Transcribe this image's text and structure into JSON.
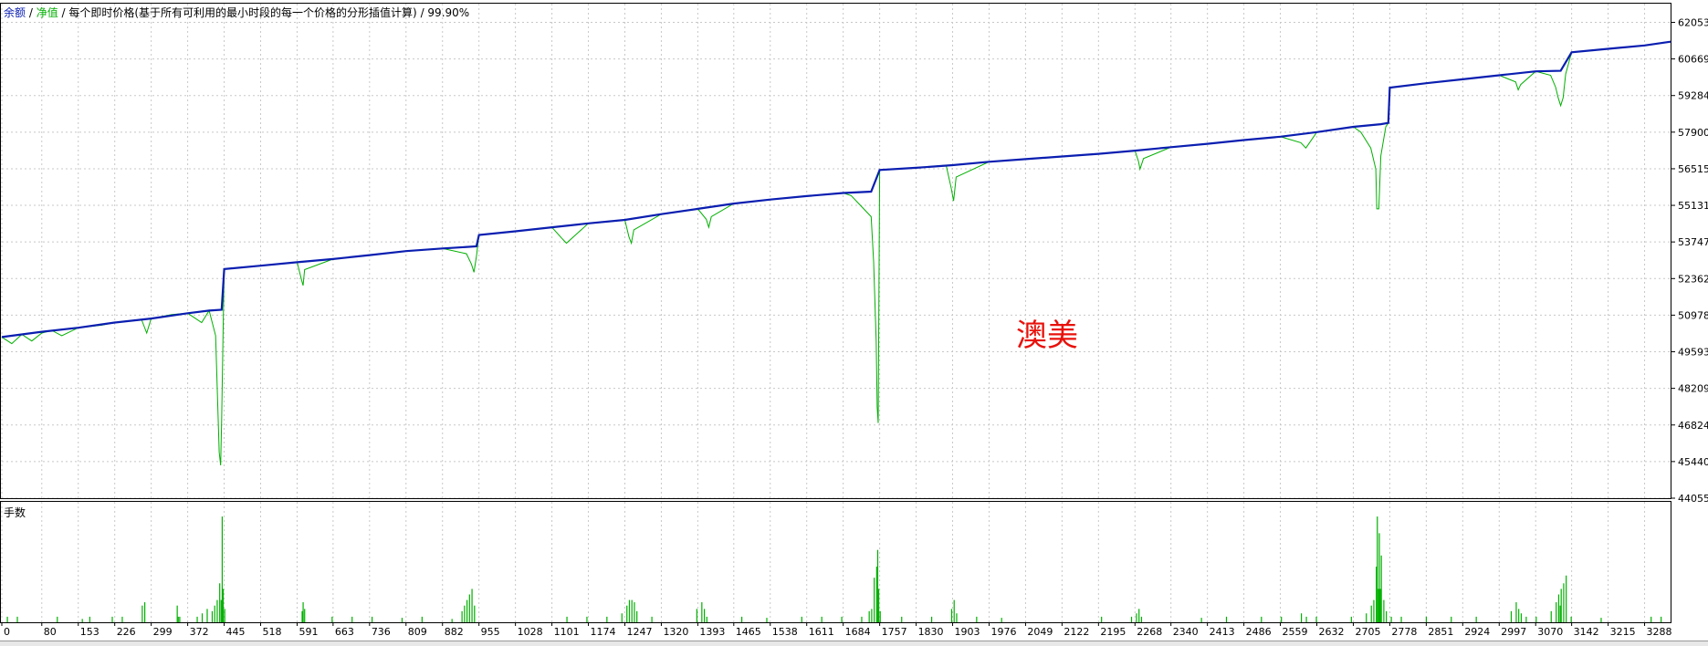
{
  "header": {
    "balance_label": "余额",
    "sep1": " / ",
    "equity_label": "净值",
    "sep2": " / ",
    "model_text": "每个即时价格(基于所有可利用的最小时段的每一个价格的分形插值计算)",
    "sep3": " / ",
    "quality": "99.90%"
  },
  "watermark": "澳美",
  "colors": {
    "balance": "#0a1eb0",
    "equity": "#00b000",
    "lots": "#00b000",
    "watermark": "#e8110b"
  },
  "chart_data": [
    {
      "type": "line",
      "title": "",
      "ylim": [
        44055,
        62760
      ],
      "y_ticks": [
        "62053",
        "60669",
        "59284",
        "57900",
        "56515",
        "55131",
        "53747",
        "52362",
        "50978",
        "49593",
        "48209",
        "46824",
        "45440",
        "44055"
      ],
      "x_range": [
        0,
        3340
      ],
      "grid": true,
      "series": [
        {
          "name": "余额",
          "x": [
            0,
            80,
            153,
            226,
            299,
            372,
            415,
            440,
            445,
            518,
            591,
            663,
            736,
            809,
            882,
            950,
            955,
            1028,
            1101,
            1174,
            1247,
            1320,
            1393,
            1465,
            1538,
            1611,
            1684,
            1740,
            1757,
            1830,
            1903,
            1976,
            2049,
            2122,
            2195,
            2268,
            2340,
            2413,
            2486,
            2559,
            2632,
            2705,
            2760,
            2775,
            2778,
            2851,
            2924,
            2997,
            3070,
            3120,
            3142,
            3215,
            3288,
            3340
          ],
          "y": [
            50150,
            50350,
            50500,
            50700,
            50850,
            51050,
            51150,
            51180,
            52720,
            52850,
            52980,
            53100,
            53250,
            53400,
            53500,
            53580,
            54010,
            54150,
            54300,
            54450,
            54580,
            54800,
            55000,
            55200,
            55350,
            55480,
            55600,
            55650,
            56470,
            56550,
            56650,
            56780,
            56880,
            56980,
            57080,
            57200,
            57330,
            57460,
            57600,
            57730,
            57900,
            58100,
            58200,
            58250,
            59580,
            59750,
            59900,
            60050,
            60200,
            60220,
            60920,
            61050,
            61180,
            61320
          ]
        },
        {
          "name": "净值",
          "x": [
            0,
            20,
            40,
            60,
            80,
            100,
            120,
            153,
            200,
            226,
            280,
            290,
            299,
            340,
            372,
            400,
            415,
            428,
            435,
            438,
            440,
            443,
            445,
            518,
            591,
            600,
            603,
            606,
            663,
            736,
            809,
            882,
            930,
            940,
            945,
            950,
            955,
            1028,
            1101,
            1120,
            1130,
            1174,
            1247,
            1255,
            1260,
            1265,
            1320,
            1393,
            1410,
            1415,
            1420,
            1465,
            1538,
            1611,
            1684,
            1700,
            1720,
            1740,
            1745,
            1750,
            1752,
            1754,
            1757,
            1830,
            1890,
            1900,
            1905,
            1910,
            1976,
            2049,
            2122,
            2195,
            2268,
            2275,
            2278,
            2285,
            2340,
            2413,
            2486,
            2559,
            2600,
            2610,
            2632,
            2705,
            2720,
            2740,
            2750,
            2752,
            2756,
            2760,
            2770,
            2775,
            2778,
            2851,
            2924,
            2997,
            3030,
            3035,
            3040,
            3070,
            3100,
            3110,
            3115,
            3120,
            3125,
            3130,
            3142,
            3215,
            3288,
            3340
          ],
          "y": [
            50150,
            49900,
            50250,
            50000,
            50300,
            50400,
            50200,
            50500,
            50600,
            50700,
            50800,
            50300,
            50850,
            51000,
            51050,
            50700,
            51150,
            50200,
            45800,
            45300,
            47000,
            50600,
            52720,
            52850,
            52980,
            52300,
            52100,
            52700,
            53100,
            53250,
            53400,
            53500,
            53300,
            52900,
            52600,
            53200,
            54010,
            54150,
            54300,
            53900,
            53700,
            54450,
            54580,
            53950,
            53700,
            54200,
            54800,
            55000,
            54600,
            54300,
            54700,
            55200,
            55350,
            55480,
            55600,
            55500,
            55100,
            54700,
            53000,
            50000,
            47500,
            46900,
            56470,
            56550,
            56650,
            55800,
            55300,
            56200,
            56780,
            56880,
            56980,
            57080,
            57200,
            56800,
            56500,
            56900,
            57330,
            57460,
            57600,
            57730,
            57500,
            57300,
            57900,
            58100,
            57900,
            57300,
            56500,
            55000,
            55000,
            57000,
            58100,
            58250,
            59580,
            59750,
            59900,
            60050,
            59800,
            59500,
            59700,
            60200,
            60050,
            59600,
            59200,
            58900,
            59200,
            60100,
            60920,
            61050,
            61180,
            61320
          ]
        }
      ]
    },
    {
      "type": "bar",
      "title": "手数",
      "x_ticks": [
        "0",
        "80",
        "153",
        "226",
        "299",
        "372",
        "445",
        "518",
        "591",
        "663",
        "736",
        "809",
        "882",
        "955",
        "1028",
        "1101",
        "1174",
        "1247",
        "1320",
        "1393",
        "1465",
        "1538",
        "1611",
        "1684",
        "1757",
        "1830",
        "1903",
        "1976",
        "2049",
        "2122",
        "2195",
        "2268",
        "2340",
        "2413",
        "2486",
        "2559",
        "2632",
        "2705",
        "2778",
        "2851",
        "2924",
        "2997",
        "3070",
        "3142",
        "3215",
        "3288"
      ],
      "ylim": [
        0,
        1.0
      ],
      "x": [
        10,
        30,
        110,
        160,
        175,
        220,
        240,
        280,
        285,
        350,
        352,
        355,
        390,
        400,
        410,
        420,
        425,
        430,
        435,
        438,
        440,
        442,
        445,
        600,
        602,
        605,
        660,
        700,
        740,
        800,
        840,
        900,
        920,
        925,
        930,
        935,
        940,
        945,
        1130,
        1170,
        1210,
        1240,
        1250,
        1255,
        1260,
        1265,
        1270,
        1300,
        1390,
        1400,
        1405,
        1410,
        1480,
        1530,
        1600,
        1640,
        1680,
        1720,
        1735,
        1740,
        1745,
        1750,
        1752,
        1754,
        1757,
        1800,
        1860,
        1900,
        1905,
        1910,
        1950,
        2000,
        2200,
        2260,
        2270,
        2275,
        2280,
        2400,
        2450,
        2520,
        2560,
        2600,
        2610,
        2630,
        2700,
        2730,
        2740,
        2745,
        2750,
        2752,
        2754,
        2756,
        2758,
        2760,
        2765,
        2770,
        2780,
        2800,
        2850,
        2900,
        2950,
        3020,
        3030,
        3035,
        3040,
        3050,
        3070,
        3100,
        3110,
        3115,
        3118,
        3120,
        3125,
        3130,
        3140,
        3200,
        3300,
        3320
      ],
      "values": [
        0.05,
        0.05,
        0.05,
        0.03,
        0.05,
        0.05,
        0.05,
        0.15,
        0.18,
        0.15,
        0.05,
        0.05,
        0.05,
        0.08,
        0.12,
        0.1,
        0.15,
        0.2,
        0.35,
        0.2,
        0.95,
        0.3,
        0.12,
        0.1,
        0.18,
        0.12,
        0.05,
        0.05,
        0.05,
        0.04,
        0.05,
        0.03,
        0.1,
        0.15,
        0.2,
        0.25,
        0.3,
        0.15,
        0.05,
        0.05,
        0.05,
        0.08,
        0.15,
        0.2,
        0.2,
        0.18,
        0.1,
        0.05,
        0.12,
        0.18,
        0.12,
        0.05,
        0.05,
        0.04,
        0.05,
        0.05,
        0.05,
        0.05,
        0.1,
        0.12,
        0.4,
        0.5,
        0.65,
        0.3,
        0.1,
        0.05,
        0.05,
        0.12,
        0.2,
        0.08,
        0.05,
        0.04,
        0.05,
        0.05,
        0.08,
        0.12,
        0.05,
        0.04,
        0.05,
        0.05,
        0.05,
        0.08,
        0.05,
        0.05,
        0.05,
        0.08,
        0.15,
        0.2,
        0.5,
        0.95,
        0.3,
        0.8,
        0.3,
        0.6,
        0.2,
        0.1,
        0.05,
        0.05,
        0.05,
        0.05,
        0.05,
        0.1,
        0.18,
        0.12,
        0.08,
        0.05,
        0.05,
        0.1,
        0.18,
        0.25,
        0.15,
        0.3,
        0.35,
        0.42,
        0.05,
        0.04,
        0.05,
        0.05
      ]
    }
  ]
}
